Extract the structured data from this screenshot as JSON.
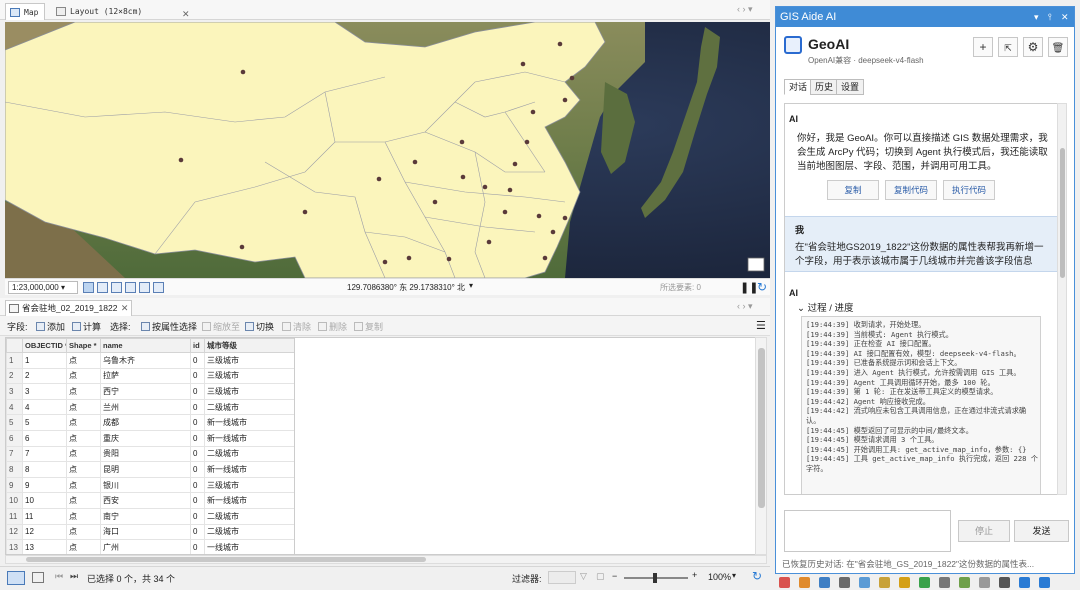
{
  "tabs": {
    "map": "Map",
    "layout": "Layout (12×8cm)"
  },
  "map": {
    "scale": "1:23,000,000",
    "coordinates": "129.7086380° 东 29.1738310° 北",
    "selected_features": "所选要素: 0",
    "city_dots": 34
  },
  "table": {
    "tab_title": "省会驻地_02_2019_1822",
    "toolbar": {
      "fields_label": "字段:",
      "add": "添加",
      "calculate": "计算",
      "selection_label": "选择:",
      "select_by_attr": "按属性选择",
      "zoom_to": "缩放至",
      "switch": "切换",
      "clear": "清除",
      "delete": "删除",
      "copy": "复制"
    },
    "columns": [
      "OBJECTID *",
      "Shape *",
      "name",
      "id",
      "城市等级"
    ],
    "rows": [
      [
        "1",
        "1",
        "点",
        "乌鲁木齐",
        "0",
        "三级城市"
      ],
      [
        "2",
        "2",
        "点",
        "拉萨",
        "0",
        "三级城市"
      ],
      [
        "3",
        "3",
        "点",
        "西宁",
        "0",
        "三级城市"
      ],
      [
        "4",
        "4",
        "点",
        "兰州",
        "0",
        "二级城市"
      ],
      [
        "5",
        "5",
        "点",
        "成都",
        "0",
        "新一线城市"
      ],
      [
        "6",
        "6",
        "点",
        "重庆",
        "0",
        "新一线城市"
      ],
      [
        "7",
        "7",
        "点",
        "贵阳",
        "0",
        "二级城市"
      ],
      [
        "8",
        "8",
        "点",
        "昆明",
        "0",
        "新一线城市"
      ],
      [
        "9",
        "9",
        "点",
        "银川",
        "0",
        "三级城市"
      ],
      [
        "10",
        "10",
        "点",
        "西安",
        "0",
        "新一线城市"
      ],
      [
        "11",
        "11",
        "点",
        "南宁",
        "0",
        "二级城市"
      ],
      [
        "12",
        "12",
        "点",
        "海口",
        "0",
        "二级城市"
      ],
      [
        "13",
        "13",
        "点",
        "广州",
        "0",
        "一线城市"
      ]
    ],
    "status": "已选择 0 个，共 34 个",
    "filter_label": "过滤器:",
    "zoom": "100%"
  },
  "panel": {
    "title": "GIS Aide AI",
    "app_name": "GeoAI",
    "model_info": "OpenAI兼容 · deepseek-v4-flash",
    "tabs": [
      "对话",
      "历史",
      "设置"
    ],
    "messages": {
      "ai1_who": "AI",
      "ai1_text": "你好，我是 GeoAI。你可以直接描述 GIS 数据处理需求，我会生成 ArcPy 代码；切换到 Agent 执行模式后，我还能读取当前地图图层、字段、范围，并调用可用工具。",
      "ai1_buttons": [
        "复制",
        "复制代码",
        "执行代码"
      ],
      "user_who": "我",
      "user_text": "在\"省会驻地GS2019_1822\"这份数据的属性表帮我再新增一个字段，用于表示该城市属于几线城市并完善该字段信息",
      "ai2_who": "AI",
      "progress_label": "过程 / 进度",
      "log": [
        "[19:44:39] 收到请求，开始处理。",
        "[19:44:39] 当前模式: Agent 执行模式。",
        "[19:44:39] 正在检查 AI 接口配置。",
        "[19:44:39] AI 接口配置有效，模型: deepseek-v4-flash。",
        "[19:44:39] 已准备系统提示词和会话上下文。",
        "[19:44:39] 进入 Agent 执行模式，允许按需调用 GIS 工具。",
        "[19:44:39] Agent 工具调用循环开始，最多 100 轮。",
        "[19:44:39] 第 1 轮: 正在发送带工具定义的模型请求。",
        "[19:44:42] Agent 响应接收完成。",
        "[19:44:42] 流式响应未包含工具调用信息，正在通过非流式请求确认。",
        "[19:44:45] 模型返回了可显示的中间/最终文本。",
        "[19:44:45] 模型请求调用 3 个工具。",
        "[19:44:45] 开始调用工具: get_active_map_info，参数: {}",
        "[19:44:45] 工具 get_active_map_info 执行完成，返回 228 个字符。"
      ]
    },
    "stop_button": "停止",
    "send_button": "发送",
    "status_text": "已恢复历史对话: 在\"省会驻地_GS_2019_1822\"这份数据的属性表..."
  }
}
